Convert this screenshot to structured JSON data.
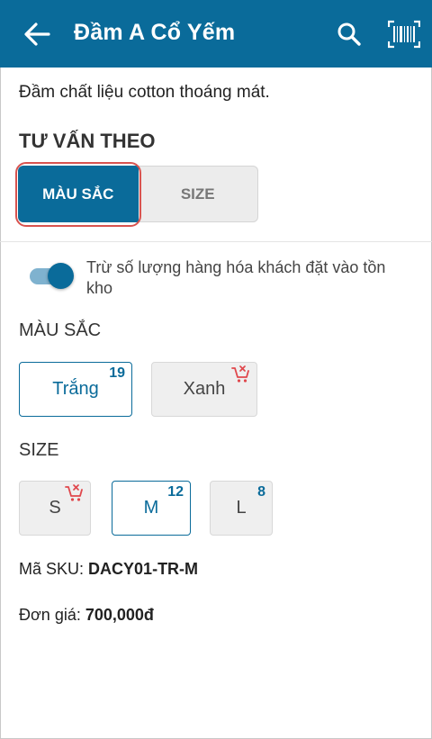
{
  "header": {
    "title": "Đầm A Cổ Yếm",
    "icons": [
      "back-arrow-icon",
      "search-icon",
      "barcode-icon"
    ],
    "background": "#0a6b9a"
  },
  "product": {
    "description": "Đầm chất liệu cotton thoáng mát."
  },
  "advice": {
    "title": "TƯ VẤN THEO",
    "tabs": [
      {
        "label": "MÀU SẮC",
        "active": true
      },
      {
        "label": "SIZE",
        "active": false
      }
    ]
  },
  "toggle": {
    "label": "Trừ số lượng hàng hóa khách đặt vào tồn kho",
    "on": true
  },
  "colors": {
    "label": "MÀU SẮC",
    "options": [
      {
        "label": "Trắng",
        "count": "19",
        "selected": true,
        "out_of_stock": false
      },
      {
        "label": "Xanh",
        "count": "",
        "selected": false,
        "out_of_stock": true
      }
    ]
  },
  "sizes": {
    "label": "SIZE",
    "options": [
      {
        "label": "S",
        "count": "",
        "selected": false,
        "out_of_stock": true
      },
      {
        "label": "M",
        "count": "12",
        "selected": true,
        "out_of_stock": false
      },
      {
        "label": "L",
        "count": "8",
        "selected": false,
        "out_of_stock": false
      }
    ]
  },
  "sku": {
    "label": "Mã SKU:",
    "value": "DACY01-TR-M"
  },
  "price": {
    "label": "Đơn giá:",
    "value": "700,000đ"
  },
  "colors_theme": {
    "accent": "#0a6b9a",
    "danger": "#e0474c"
  }
}
